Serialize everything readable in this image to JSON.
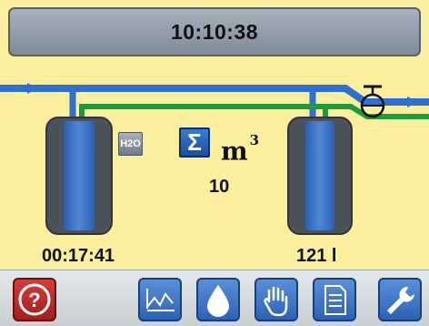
{
  "header": {
    "clock": "10:10:38"
  },
  "flow": {
    "meter_icon_label": "H2O",
    "sum_symbol": "Σ",
    "unit": "m",
    "unit_exponent": "3",
    "value": "10"
  },
  "left_tank": {
    "runtime": "00:17:41"
  },
  "right_tank": {
    "volume": "121 l"
  },
  "toolbar": {
    "buttons": [
      "help-icon",
      "chart-icon",
      "water-drop-icon",
      "hand-icon",
      "document-icon",
      "wrench-icon"
    ]
  },
  "colors": {
    "background": "#fbee9c",
    "water_pipe": "#2f6fd0",
    "green_pipe": "#1f9a3a",
    "tank_body": "#4c525a",
    "tank_fill": "#3f73c6",
    "help_button": "#c22b27",
    "toolbar_button": "#3f74c4"
  }
}
